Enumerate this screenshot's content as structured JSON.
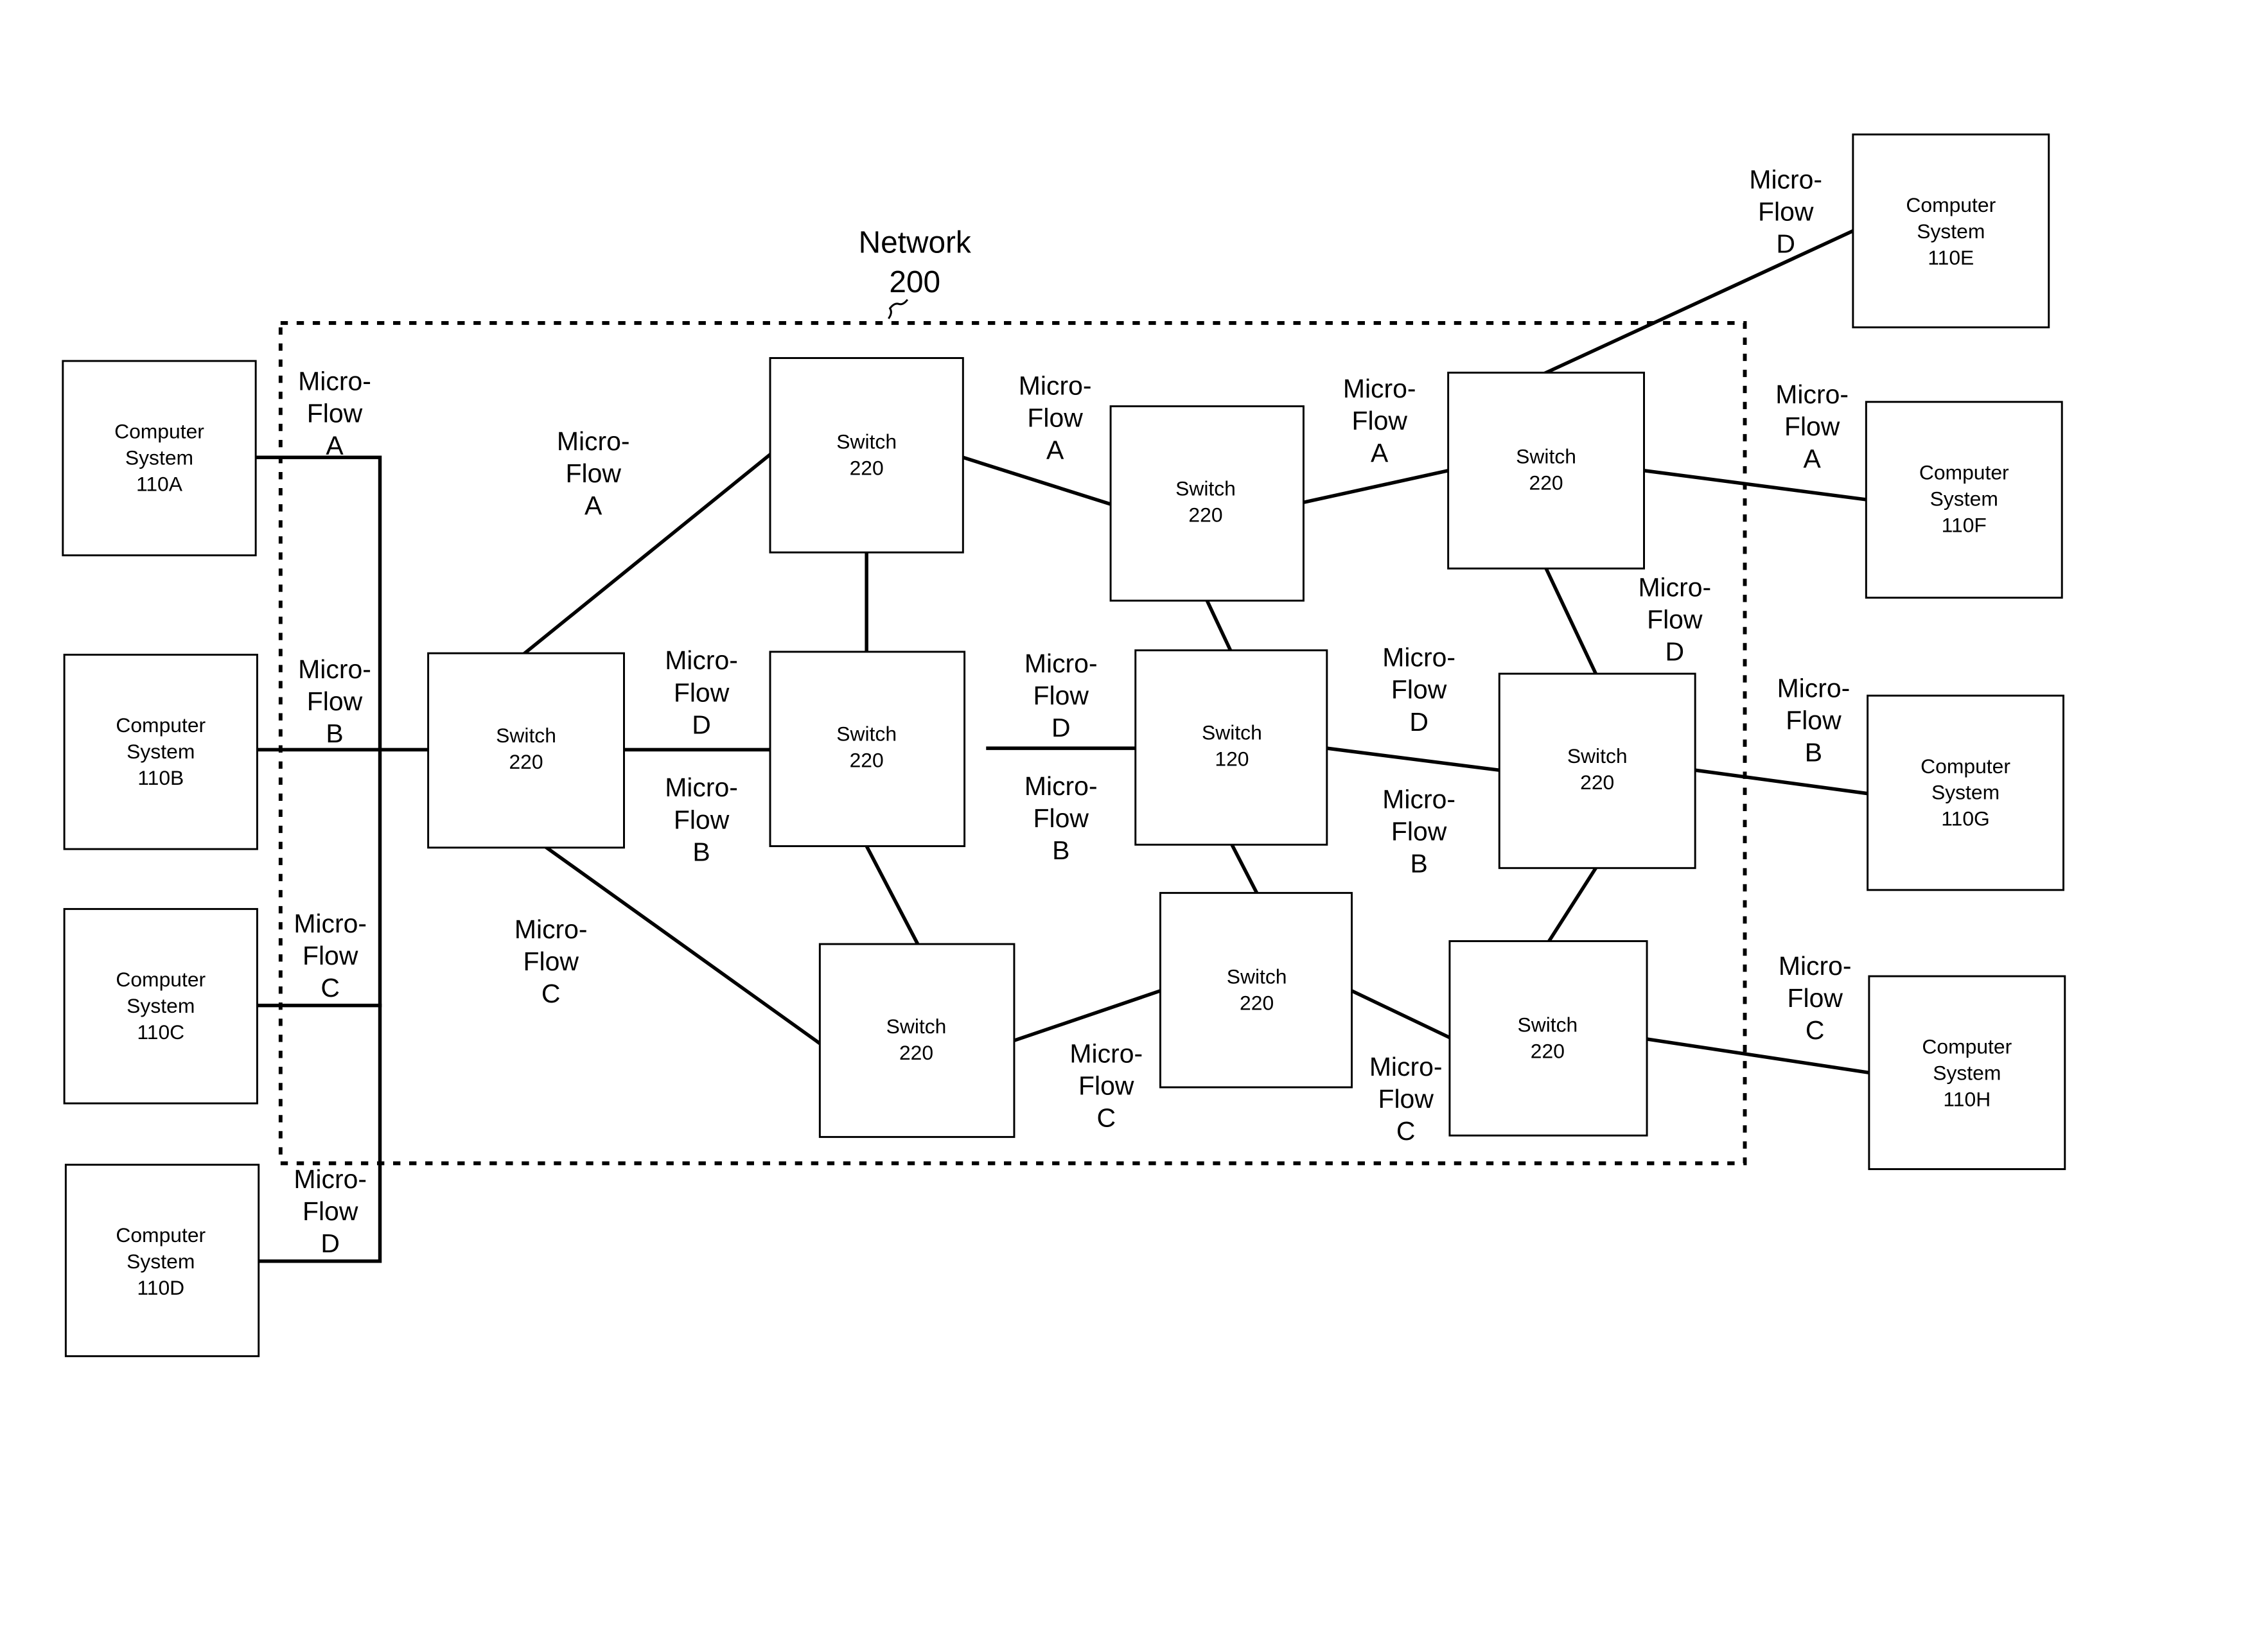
{
  "network": {
    "label_line1": "Network",
    "label_line2": "200"
  },
  "computer_systems": [
    {
      "id": "110A",
      "line1": "Computer",
      "line2": "System",
      "line3": "110A"
    },
    {
      "id": "110B",
      "line1": "Computer",
      "line2": "System",
      "line3": "110B"
    },
    {
      "id": "110C",
      "line1": "Computer",
      "line2": "System",
      "line3": "110C"
    },
    {
      "id": "110D",
      "line1": "Computer",
      "line2": "System",
      "line3": "110D"
    },
    {
      "id": "110E",
      "line1": "Computer",
      "line2": "System",
      "line3": "110E"
    },
    {
      "id": "110F",
      "line1": "Computer",
      "line2": "System",
      "line3": "110F"
    },
    {
      "id": "110G",
      "line1": "Computer",
      "line2": "System",
      "line3": "110G"
    },
    {
      "id": "110H",
      "line1": "Computer",
      "line2": "System",
      "line3": "110H"
    }
  ],
  "switches": [
    {
      "key": "s-left",
      "line1": "Switch",
      "line2": "220"
    },
    {
      "key": "s-top-1",
      "line1": "Switch",
      "line2": "220"
    },
    {
      "key": "s-mid-1",
      "line1": "Switch",
      "line2": "220"
    },
    {
      "key": "s-bot-1",
      "line1": "Switch",
      "line2": "220"
    },
    {
      "key": "s-top-2",
      "line1": "Switch",
      "line2": "220"
    },
    {
      "key": "s-center",
      "line1": "Switch",
      "line2": "120"
    },
    {
      "key": "s-bot-2",
      "line1": "Switch",
      "line2": "220"
    },
    {
      "key": "s-top-3",
      "line1": "Switch",
      "line2": "220"
    },
    {
      "key": "s-mid-3",
      "line1": "Switch",
      "line2": "220"
    },
    {
      "key": "s-bot-3",
      "line1": "Switch",
      "line2": "220"
    }
  ],
  "flow_labels": [
    {
      "line1": "Micro-",
      "line2": "Flow",
      "line3": "A"
    },
    {
      "line1": "Micro-",
      "line2": "Flow",
      "line3": "B"
    },
    {
      "line1": "Micro-",
      "line2": "Flow",
      "line3": "C"
    },
    {
      "line1": "Micro-",
      "line2": "Flow",
      "line3": "D"
    },
    {
      "line1": "Micro-",
      "line2": "Flow",
      "line3": "A"
    },
    {
      "line1": "Micro-",
      "line2": "Flow",
      "line3": "D"
    },
    {
      "line1": "Micro-",
      "line2": "Flow",
      "line3": "B"
    },
    {
      "line1": "Micro-",
      "line2": "Flow",
      "line3": "C"
    },
    {
      "line1": "Micro-",
      "line2": "Flow",
      "line3": "A"
    },
    {
      "line1": "Micro-",
      "line2": "Flow",
      "line3": "D"
    },
    {
      "line1": "Micro-",
      "line2": "Flow",
      "line3": "B"
    },
    {
      "line1": "Micro-",
      "line2": "Flow",
      "line3": "A"
    },
    {
      "line1": "Micro-",
      "line2": "Flow",
      "line3": "D"
    },
    {
      "line1": "Micro-",
      "line2": "Flow",
      "line3": "B"
    },
    {
      "line1": "Micro-",
      "line2": "Flow",
      "line3": "C"
    },
    {
      "line1": "Micro-",
      "line2": "Flow",
      "line3": "C"
    },
    {
      "line1": "Micro-",
      "line2": "Flow",
      "line3": "D"
    },
    {
      "line1": "Micro-",
      "line2": "Flow",
      "line3": "D"
    },
    {
      "line1": "Micro-",
      "line2": "Flow",
      "line3": "A"
    },
    {
      "line1": "Micro-",
      "line2": "Flow",
      "line3": "B"
    },
    {
      "line1": "Micro-",
      "line2": "Flow",
      "line3": "C"
    }
  ]
}
